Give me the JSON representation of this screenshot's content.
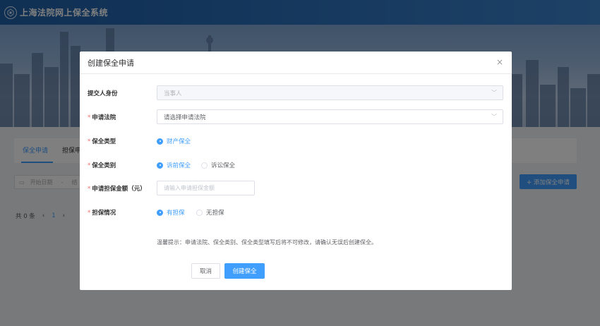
{
  "site": {
    "title": "上海法院网上保全系统",
    "logo_icon": "court-emblem-icon"
  },
  "page": {
    "tabs": [
      "保全申请",
      "担保申"
    ],
    "filter_placeholder": "开始日期",
    "filter_sep": "-",
    "filter_end": "结",
    "add_button": "+ 添加保全申请",
    "pager": {
      "total": "共 0 条",
      "prev": "‹",
      "current": "1",
      "next": "›"
    }
  },
  "dialog": {
    "title": "创建保全申请",
    "close_icon": "×",
    "fields": {
      "identity": {
        "label": "提交人身份",
        "value": "当事人"
      },
      "court": {
        "label": "申请法院",
        "placeholder": "请选择申请法院"
      },
      "type": {
        "label": "保全类型",
        "options": [
          "财产保全"
        ],
        "selected": "财产保全"
      },
      "category": {
        "label": "保全类别",
        "options": [
          "诉前保全",
          "诉讼保全"
        ],
        "selected": "诉前保全"
      },
      "amount": {
        "label": "申请担保金额（元）",
        "placeholder": "请输入申请担保金额"
      },
      "guarantee": {
        "label": "担保情况",
        "options": [
          "有担保",
          "无担保"
        ],
        "selected": "有担保"
      }
    },
    "tip": "温馨提示：申请法院、保全类别、保全类型填写后将不可修改，请确认无误后创建保全。",
    "buttons": {
      "cancel": "取消",
      "create": "创建保全"
    }
  },
  "colors": {
    "primary": "#409eff",
    "header": "#2f74c0",
    "required": "#f56c6c"
  }
}
